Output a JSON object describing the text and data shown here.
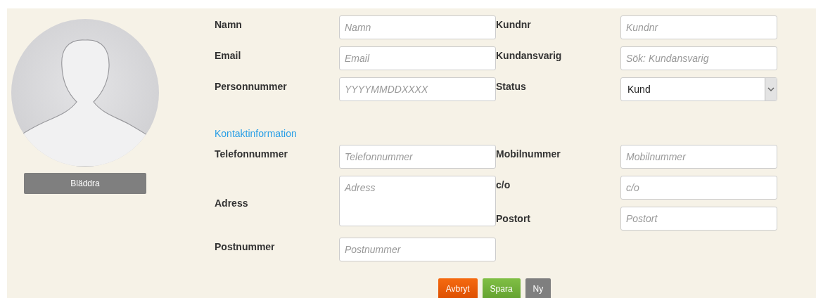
{
  "avatar": {
    "button": "Bläddra"
  },
  "main_fields": [
    {
      "kind": "input",
      "label": "Namn",
      "placeholder": "Namn"
    },
    {
      "kind": "input",
      "label": "Kundnr",
      "placeholder": "Kundnr"
    },
    {
      "kind": "input",
      "label": "Email",
      "placeholder": "Email"
    },
    {
      "kind": "input",
      "label": "Kundansvarig",
      "placeholder": "Sök: Kundansvarig"
    },
    {
      "kind": "input",
      "label": "Personnummer",
      "placeholder": "YYYYMMDDXXXX"
    },
    {
      "kind": "select",
      "label": "Status",
      "value": "Kund"
    }
  ],
  "contact_section": {
    "title": "Kontaktinformation"
  },
  "contact_fields": [
    {
      "kind": "input",
      "label": "Telefonnummer",
      "placeholder": "Telefonnummer"
    },
    {
      "kind": "input",
      "label": "Mobilnummer",
      "placeholder": "Mobilnummer"
    },
    {
      "kind": "textarea",
      "label": "Adress",
      "placeholder": "Adress"
    },
    {
      "kind": "input",
      "label": "c/o",
      "placeholder": "c/o"
    },
    {
      "kind": "input",
      "label": "Postort",
      "placeholder": "Postort"
    },
    {
      "kind": "input",
      "label": "Postnummer",
      "placeholder": "Postnummer"
    }
  ],
  "buttons": [
    {
      "kind": "cancel",
      "label": "Avbryt"
    },
    {
      "kind": "save",
      "label": "Spara"
    },
    {
      "kind": "new",
      "label": "Ny"
    }
  ]
}
